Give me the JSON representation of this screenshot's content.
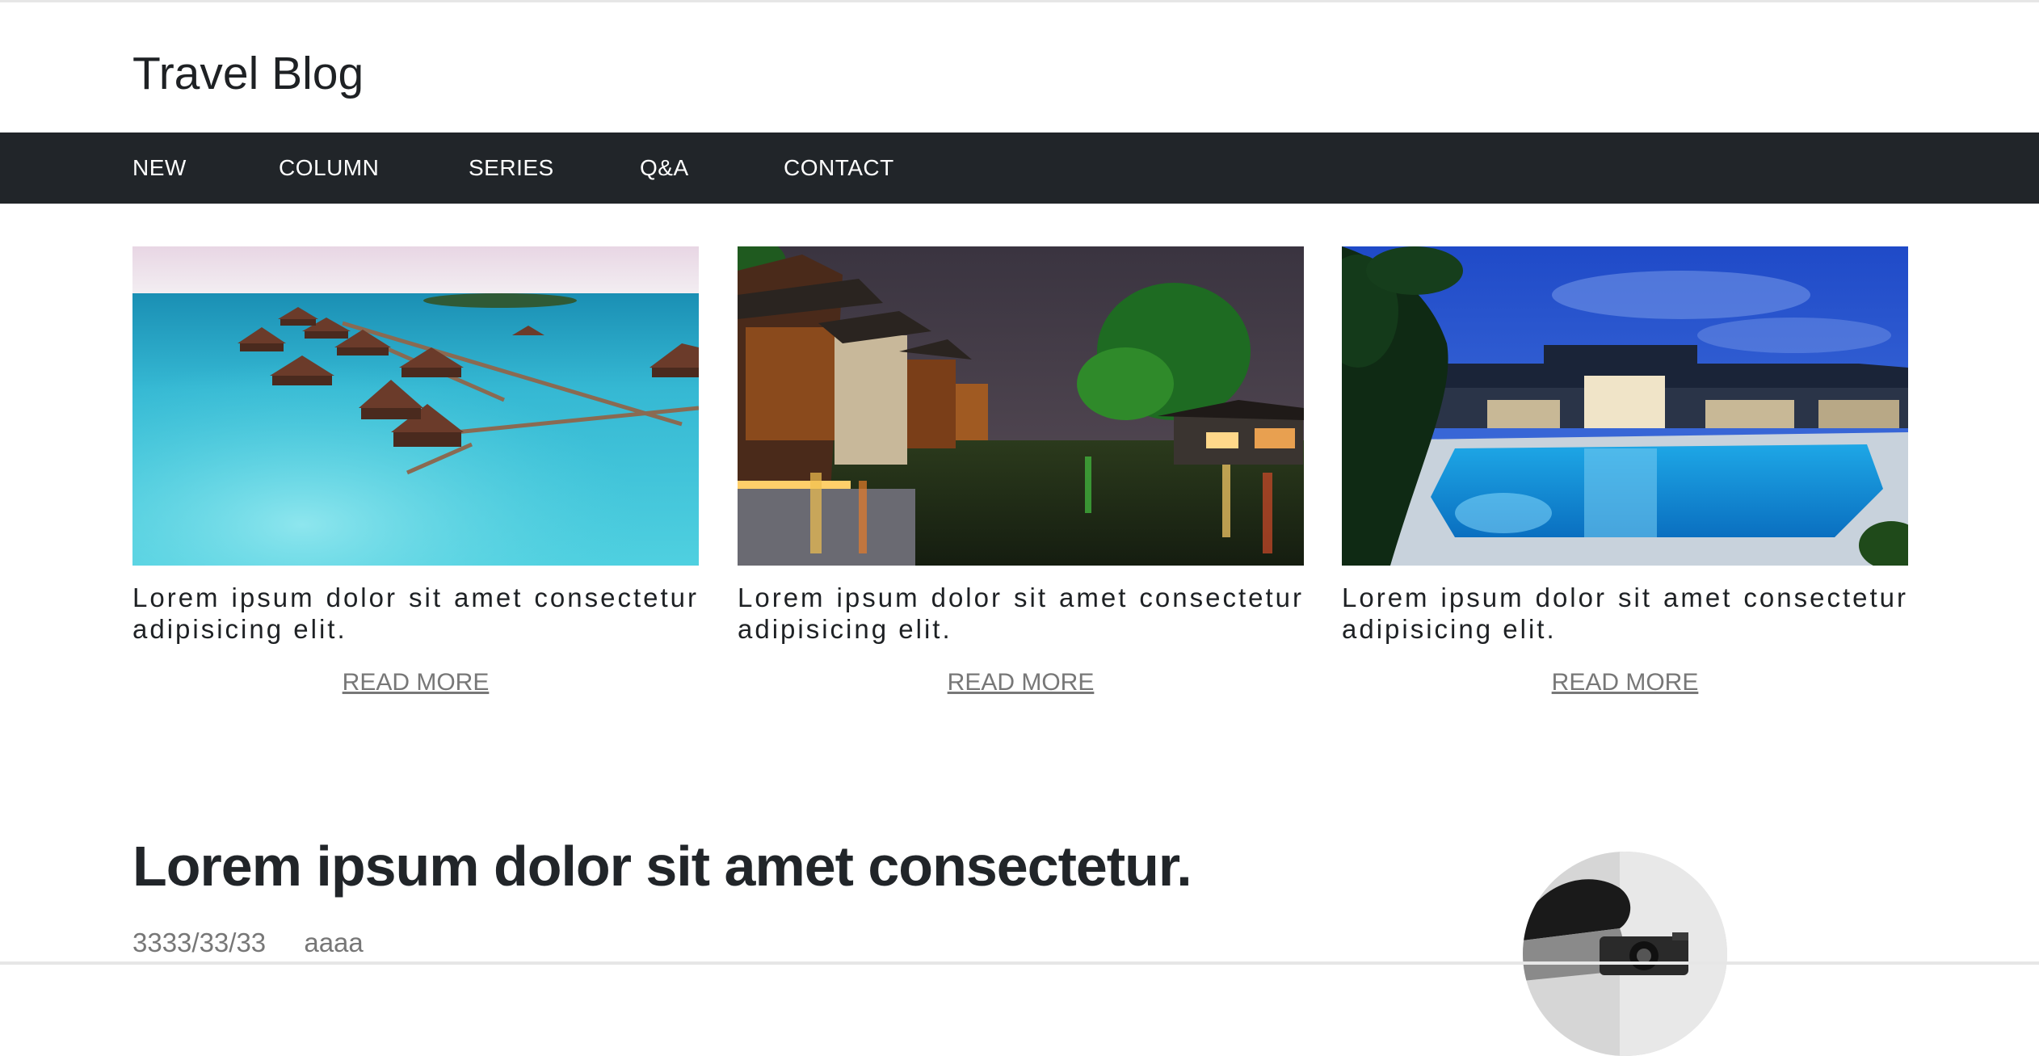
{
  "header": {
    "site_title": "Travel Blog"
  },
  "nav": {
    "items": [
      {
        "label": "NEW"
      },
      {
        "label": "COLUMN"
      },
      {
        "label": "SERIES"
      },
      {
        "label": "Q&A"
      },
      {
        "label": "CONTACT"
      }
    ]
  },
  "cards": [
    {
      "image": "overwater-bungalows-photo",
      "text": "Lorem ipsum dolor sit amet consectetur adipisicing elit.",
      "link_label": "READ MORE"
    },
    {
      "image": "night-canal-town-photo",
      "text": "Lorem ipsum dolor sit amet consectetur adipisicing elit.",
      "link_label": "READ MORE"
    },
    {
      "image": "resort-pool-photo",
      "text": "Lorem ipsum dolor sit amet consectetur adipisicing elit.",
      "link_label": "READ MORE"
    }
  ],
  "post": {
    "title": "Lorem ipsum dolor sit amet consectetur.",
    "date": "3333/33/33",
    "author": "aaaa"
  },
  "colors": {
    "navbar_bg": "#212529",
    "nav_text": "#ffffff",
    "link_gray": "#777777",
    "title_text": "#1e2124"
  }
}
